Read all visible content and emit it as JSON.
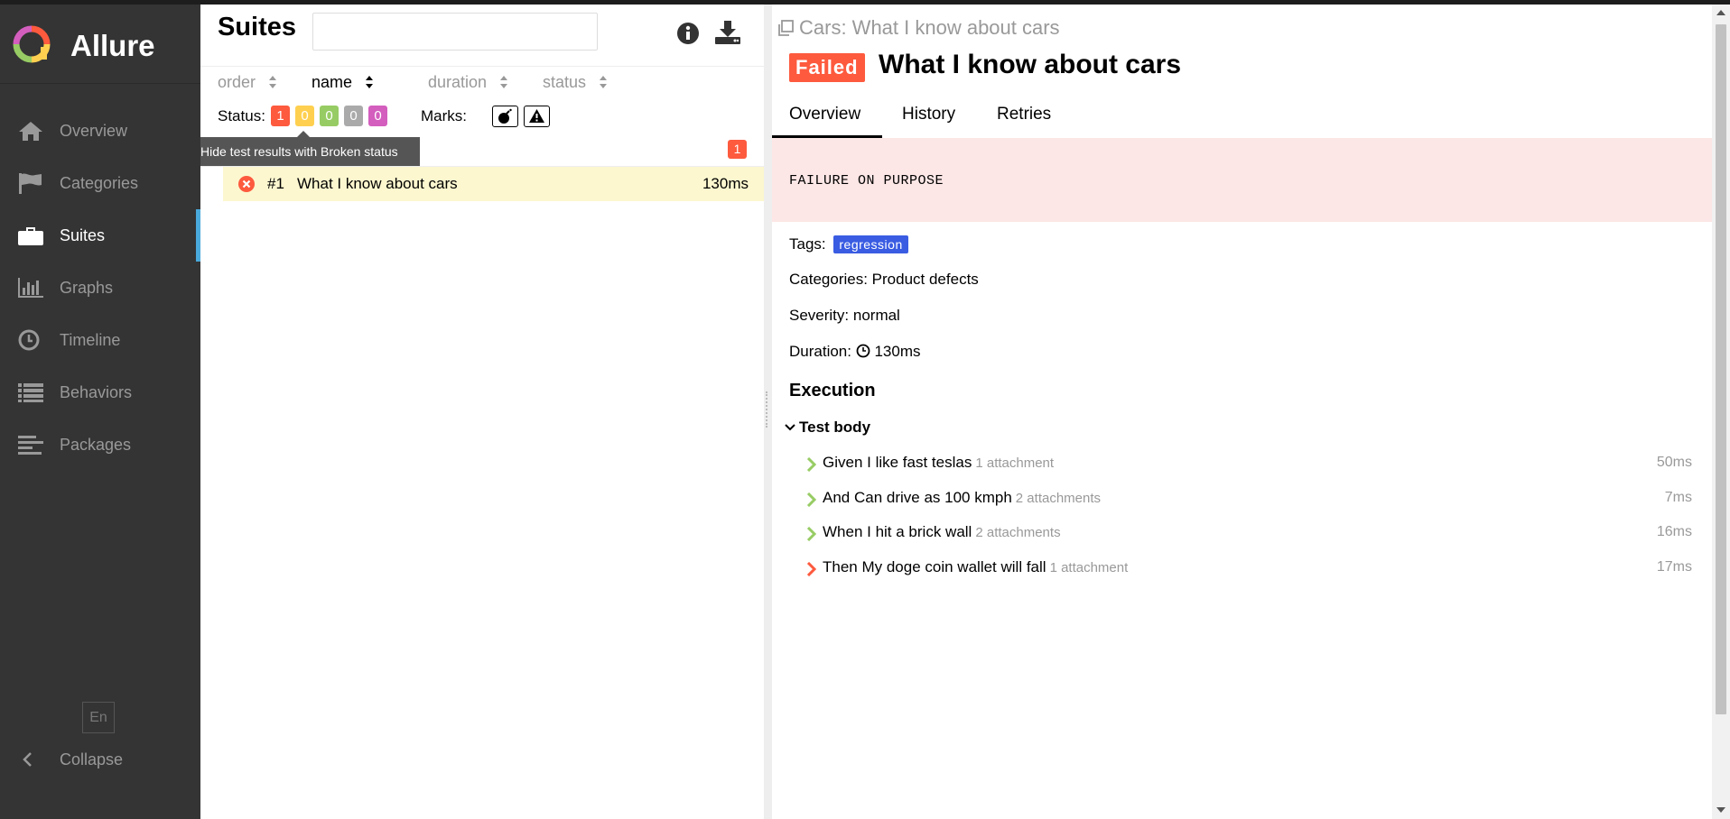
{
  "app": {
    "name": "Allure"
  },
  "sidebar": {
    "items": [
      {
        "label": "Overview",
        "icon": "home-icon"
      },
      {
        "label": "Categories",
        "icon": "flag-icon"
      },
      {
        "label": "Suites",
        "icon": "briefcase-icon",
        "active": true
      },
      {
        "label": "Graphs",
        "icon": "bar-chart-icon"
      },
      {
        "label": "Timeline",
        "icon": "clock-icon"
      },
      {
        "label": "Behaviors",
        "icon": "list-icon"
      },
      {
        "label": "Packages",
        "icon": "align-left-icon"
      }
    ],
    "language": "En",
    "collapse_label": "Collapse"
  },
  "suites": {
    "title": "Suites",
    "search": {
      "value": "",
      "placeholder": ""
    },
    "sort": {
      "order": "order",
      "name": "name",
      "duration": "duration",
      "status": "status"
    },
    "status_label": "Status:",
    "status_counts": [
      {
        "status": "failed",
        "count": "1",
        "color": "#fd5a3e"
      },
      {
        "status": "broken",
        "count": "0",
        "color": "#ffd050"
      },
      {
        "status": "passed",
        "count": "0",
        "color": "#97cc64"
      },
      {
        "status": "skipped",
        "count": "0",
        "color": "#aaaaaa"
      },
      {
        "status": "unknown",
        "count": "0",
        "color": "#d35ebe"
      }
    ],
    "marks_label": "Marks:",
    "tooltip": "Hide test results with Broken status",
    "group_count": "1",
    "tests": [
      {
        "number": "#1",
        "name": "What I know about cars",
        "duration": "130ms",
        "status": "failed"
      }
    ]
  },
  "detail": {
    "breadcrumb": "Cars: What I know about cars",
    "status_badge": "Failed",
    "title": "What I know about cars",
    "tabs": [
      "Overview",
      "History",
      "Retries"
    ],
    "active_tab": "Overview",
    "error_message": "FAILURE ON PURPOSE",
    "tags_label": "Tags:",
    "tag": "regression",
    "categories_label": "Categories:",
    "categories": "Product defects",
    "severity_label": "Severity:",
    "severity": "normal",
    "duration_label": "Duration:",
    "duration": "130ms",
    "execution_title": "Execution",
    "test_body_label": "Test body",
    "steps": [
      {
        "name": "Given I like fast teslas",
        "attachments": "1 attachment",
        "duration": "50ms",
        "status": "passed"
      },
      {
        "name": "And Can drive as 100 kmph",
        "attachments": "2 attachments",
        "duration": "7ms",
        "status": "passed"
      },
      {
        "name": "When I hit a brick wall",
        "attachments": "2 attachments",
        "duration": "16ms",
        "status": "passed"
      },
      {
        "name": "Then My doge coin wallet will fall",
        "attachments": "1 attachment",
        "duration": "17ms",
        "status": "failed"
      }
    ]
  },
  "colors": {
    "failed": "#fd5a3e",
    "passed": "#97cc64",
    "tag": "#3a5ce2",
    "sidebar": "#343434",
    "accent": "#4aa9db"
  }
}
